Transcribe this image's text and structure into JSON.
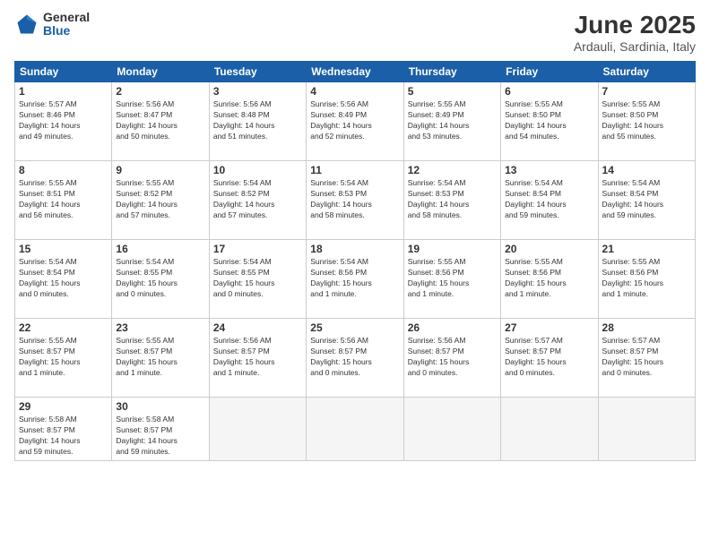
{
  "logo": {
    "general": "General",
    "blue": "Blue"
  },
  "title": "June 2025",
  "subtitle": "Ardauli, Sardinia, Italy",
  "headers": [
    "Sunday",
    "Monday",
    "Tuesday",
    "Wednesday",
    "Thursday",
    "Friday",
    "Saturday"
  ],
  "weeks": [
    [
      {
        "num": "1",
        "info": "Sunrise: 5:57 AM\nSunset: 8:46 PM\nDaylight: 14 hours\nand 49 minutes."
      },
      {
        "num": "2",
        "info": "Sunrise: 5:56 AM\nSunset: 8:47 PM\nDaylight: 14 hours\nand 50 minutes."
      },
      {
        "num": "3",
        "info": "Sunrise: 5:56 AM\nSunset: 8:48 PM\nDaylight: 14 hours\nand 51 minutes."
      },
      {
        "num": "4",
        "info": "Sunrise: 5:56 AM\nSunset: 8:49 PM\nDaylight: 14 hours\nand 52 minutes."
      },
      {
        "num": "5",
        "info": "Sunrise: 5:55 AM\nSunset: 8:49 PM\nDaylight: 14 hours\nand 53 minutes."
      },
      {
        "num": "6",
        "info": "Sunrise: 5:55 AM\nSunset: 8:50 PM\nDaylight: 14 hours\nand 54 minutes."
      },
      {
        "num": "7",
        "info": "Sunrise: 5:55 AM\nSunset: 8:50 PM\nDaylight: 14 hours\nand 55 minutes."
      }
    ],
    [
      {
        "num": "8",
        "info": "Sunrise: 5:55 AM\nSunset: 8:51 PM\nDaylight: 14 hours\nand 56 minutes."
      },
      {
        "num": "9",
        "info": "Sunrise: 5:55 AM\nSunset: 8:52 PM\nDaylight: 14 hours\nand 57 minutes."
      },
      {
        "num": "10",
        "info": "Sunrise: 5:54 AM\nSunset: 8:52 PM\nDaylight: 14 hours\nand 57 minutes."
      },
      {
        "num": "11",
        "info": "Sunrise: 5:54 AM\nSunset: 8:53 PM\nDaylight: 14 hours\nand 58 minutes."
      },
      {
        "num": "12",
        "info": "Sunrise: 5:54 AM\nSunset: 8:53 PM\nDaylight: 14 hours\nand 58 minutes."
      },
      {
        "num": "13",
        "info": "Sunrise: 5:54 AM\nSunset: 8:54 PM\nDaylight: 14 hours\nand 59 minutes."
      },
      {
        "num": "14",
        "info": "Sunrise: 5:54 AM\nSunset: 8:54 PM\nDaylight: 14 hours\nand 59 minutes."
      }
    ],
    [
      {
        "num": "15",
        "info": "Sunrise: 5:54 AM\nSunset: 8:54 PM\nDaylight: 15 hours\nand 0 minutes."
      },
      {
        "num": "16",
        "info": "Sunrise: 5:54 AM\nSunset: 8:55 PM\nDaylight: 15 hours\nand 0 minutes."
      },
      {
        "num": "17",
        "info": "Sunrise: 5:54 AM\nSunset: 8:55 PM\nDaylight: 15 hours\nand 0 minutes."
      },
      {
        "num": "18",
        "info": "Sunrise: 5:54 AM\nSunset: 8:56 PM\nDaylight: 15 hours\nand 1 minute."
      },
      {
        "num": "19",
        "info": "Sunrise: 5:55 AM\nSunset: 8:56 PM\nDaylight: 15 hours\nand 1 minute."
      },
      {
        "num": "20",
        "info": "Sunrise: 5:55 AM\nSunset: 8:56 PM\nDaylight: 15 hours\nand 1 minute."
      },
      {
        "num": "21",
        "info": "Sunrise: 5:55 AM\nSunset: 8:56 PM\nDaylight: 15 hours\nand 1 minute."
      }
    ],
    [
      {
        "num": "22",
        "info": "Sunrise: 5:55 AM\nSunset: 8:57 PM\nDaylight: 15 hours\nand 1 minute."
      },
      {
        "num": "23",
        "info": "Sunrise: 5:55 AM\nSunset: 8:57 PM\nDaylight: 15 hours\nand 1 minute."
      },
      {
        "num": "24",
        "info": "Sunrise: 5:56 AM\nSunset: 8:57 PM\nDaylight: 15 hours\nand 1 minute."
      },
      {
        "num": "25",
        "info": "Sunrise: 5:56 AM\nSunset: 8:57 PM\nDaylight: 15 hours\nand 0 minutes."
      },
      {
        "num": "26",
        "info": "Sunrise: 5:56 AM\nSunset: 8:57 PM\nDaylight: 15 hours\nand 0 minutes."
      },
      {
        "num": "27",
        "info": "Sunrise: 5:57 AM\nSunset: 8:57 PM\nDaylight: 15 hours\nand 0 minutes."
      },
      {
        "num": "28",
        "info": "Sunrise: 5:57 AM\nSunset: 8:57 PM\nDaylight: 15 hours\nand 0 minutes."
      }
    ],
    [
      {
        "num": "29",
        "info": "Sunrise: 5:58 AM\nSunset: 8:57 PM\nDaylight: 14 hours\nand 59 minutes."
      },
      {
        "num": "30",
        "info": "Sunrise: 5:58 AM\nSunset: 8:57 PM\nDaylight: 14 hours\nand 59 minutes."
      },
      {
        "num": "",
        "info": ""
      },
      {
        "num": "",
        "info": ""
      },
      {
        "num": "",
        "info": ""
      },
      {
        "num": "",
        "info": ""
      },
      {
        "num": "",
        "info": ""
      }
    ]
  ]
}
